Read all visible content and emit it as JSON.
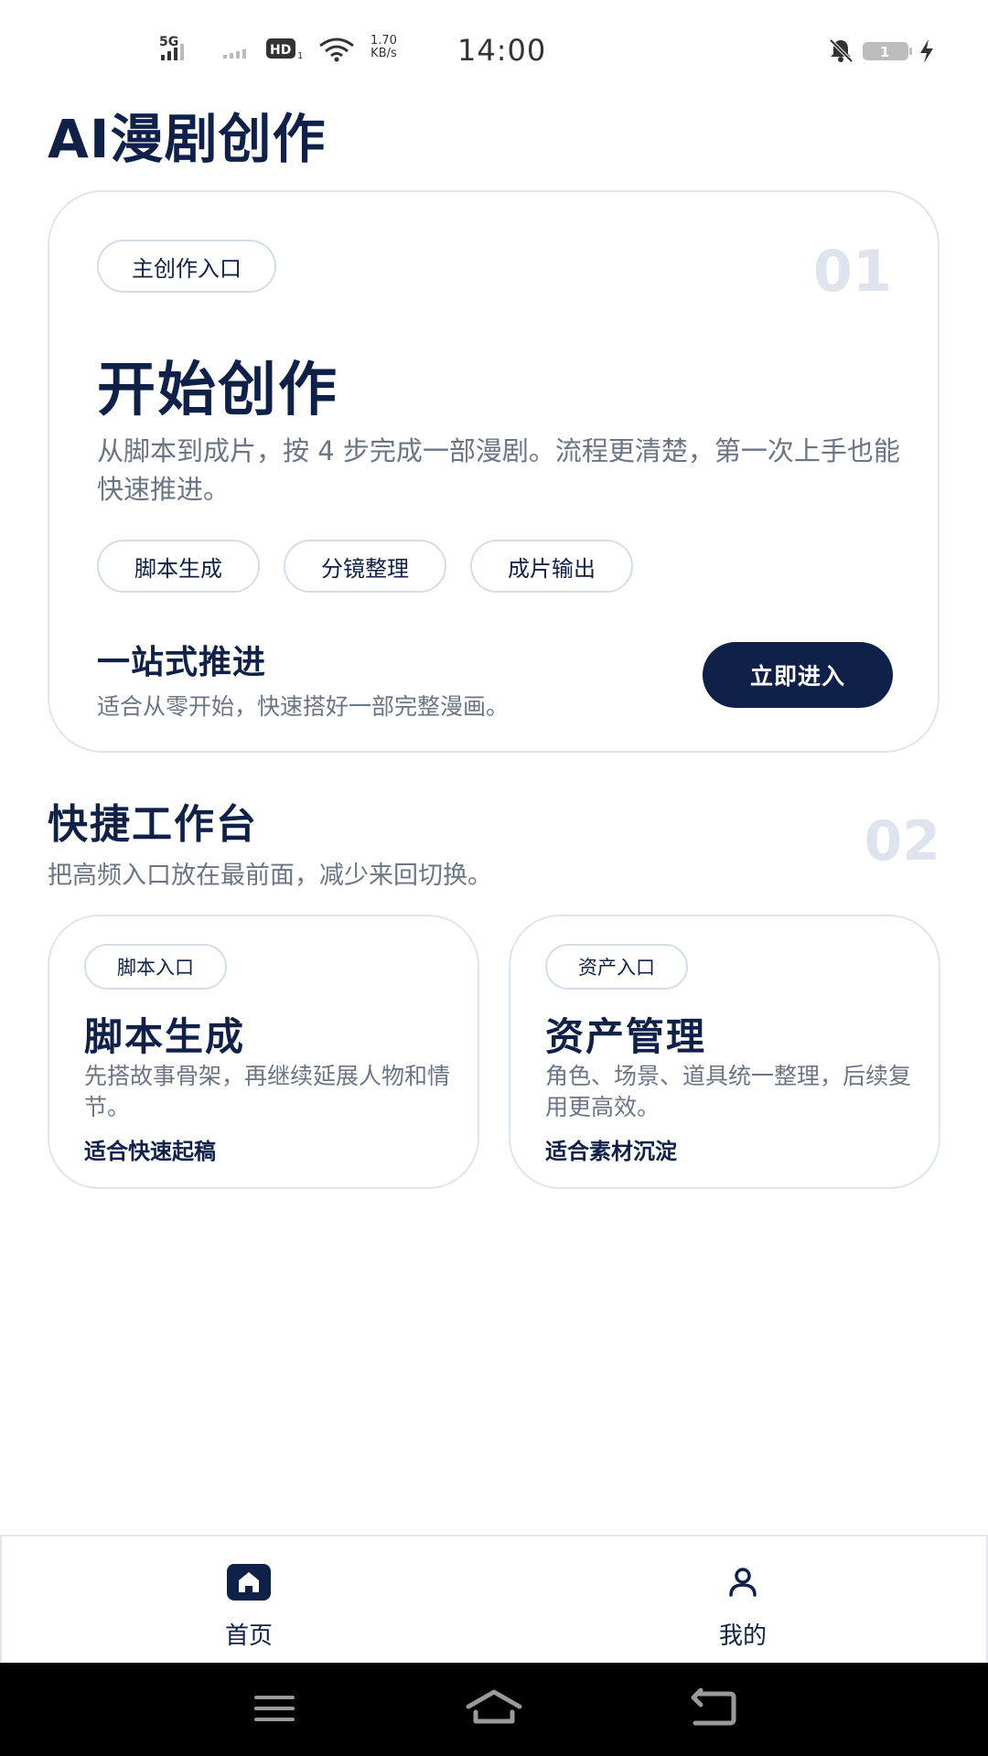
{
  "status_bar": {
    "signal_label": "5G",
    "hd_label": "HD",
    "net_speed_value": "1.70",
    "net_speed_unit": "KB/s",
    "time": "14:00",
    "battery": "1"
  },
  "app": {
    "title": "AI漫剧创作"
  },
  "main_card": {
    "tag": "主创作入口",
    "number": "01",
    "heading": "开始创作",
    "description": "从脚本到成片，按 4 步完成一部漫剧。流程更清楚，第一次上手也能快速推进。",
    "chips": [
      "脚本生成",
      "分镜整理",
      "成片输出"
    ],
    "summary_title": "一站式推进",
    "summary_sub": "适合从零开始，快速搭好一部完整漫画。",
    "enter_button": "立即进入"
  },
  "quick_section": {
    "title": "快捷工作台",
    "subtitle": "把高频入口放在最前面，减少来回切换。",
    "number": "02",
    "cards": [
      {
        "tag": "脚本入口",
        "heading": "脚本生成",
        "description": "先搭故事骨架，再继续延展人物和情节。",
        "fit": "适合快速起稿"
      },
      {
        "tag": "资产入口",
        "heading": "资产管理",
        "description": "角色、场景、道具统一整理，后续复用更高效。",
        "fit": "适合素材沉淀"
      }
    ]
  },
  "bottom_nav": {
    "items": [
      {
        "label": "首页",
        "icon": "home-icon",
        "active": true
      },
      {
        "label": "我的",
        "icon": "user-icon",
        "active": false
      }
    ]
  },
  "colors": {
    "primary": "#0f2149",
    "muted_text": "#6b7585",
    "border": "#dfe5ee",
    "number_watermark": "#dde4ee"
  }
}
